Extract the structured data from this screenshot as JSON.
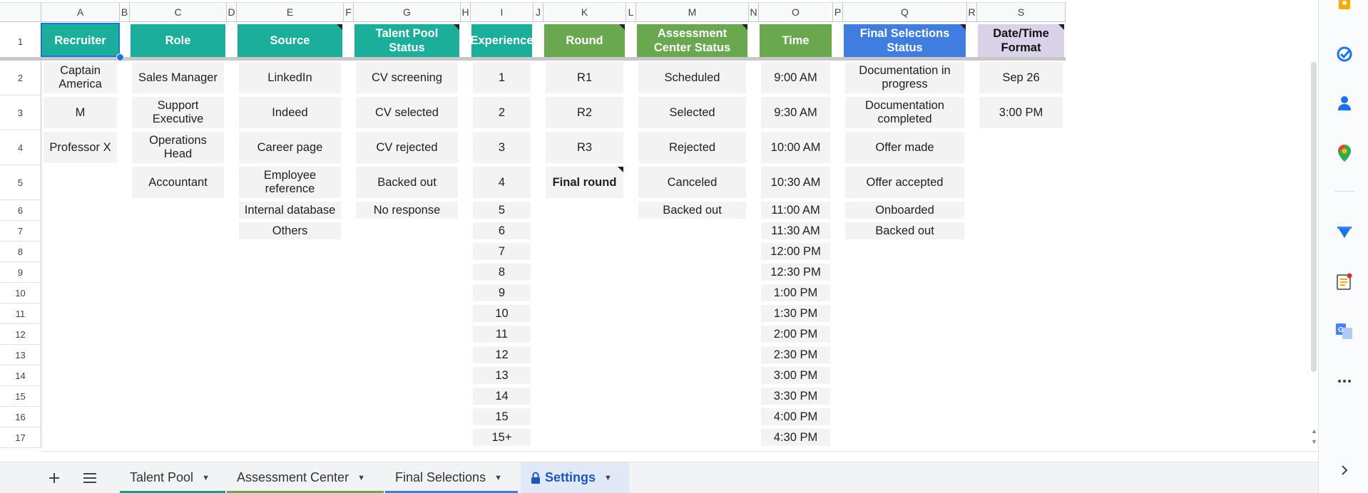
{
  "columns": [
    "A",
    "B",
    "C",
    "D",
    "E",
    "F",
    "G",
    "H",
    "I",
    "J",
    "K",
    "L",
    "M",
    "N",
    "O",
    "P",
    "Q",
    "R",
    "S"
  ],
  "rows": [
    "1",
    "2",
    "3",
    "4",
    "5",
    "6",
    "7",
    "8",
    "9",
    "10",
    "11",
    "12",
    "13",
    "14",
    "15",
    "16",
    "17"
  ],
  "headers": {
    "recruiter": "Recruiter",
    "role": "Role",
    "source": "Source",
    "talent_pool_status": "Talent Pool Status",
    "experience": "Experience",
    "round": "Round",
    "assessment_center_status": "Assessment Center Status",
    "time": "Time",
    "final_selections_status": "Final Selections Status",
    "date_time_format": "Date/Time Format"
  },
  "recruiter": [
    "Captain America",
    "M",
    "Professor X"
  ],
  "role": [
    "Sales Manager",
    "Support Executive",
    "Operations Head",
    "Accountant"
  ],
  "source": [
    "LinkedIn",
    "Indeed",
    "Career page",
    "Employee reference",
    "Internal database",
    "Others"
  ],
  "talent_pool_status": [
    "CV screening",
    "CV selected",
    "CV rejected",
    "Backed out",
    "No response"
  ],
  "experience": [
    "1",
    "2",
    "3",
    "4",
    "5",
    "6",
    "7",
    "8",
    "9",
    "10",
    "11",
    "12",
    "13",
    "14",
    "15",
    "15+"
  ],
  "round": [
    "R1",
    "R2",
    "R3",
    "Final round"
  ],
  "assessment_center_status": [
    "Scheduled",
    "Selected",
    "Rejected",
    "Canceled",
    "Backed out"
  ],
  "time": [
    "9:00 AM",
    "9:30 AM",
    "10:00 AM",
    "10:30 AM",
    "11:00 AM",
    "11:30 AM",
    "12:00 PM",
    "12:30 PM",
    "1:00 PM",
    "1:30 PM",
    "2:00 PM",
    "2:30 PM",
    "3:00 PM",
    "3:30 PM",
    "4:00 PM",
    "4:30 PM"
  ],
  "final_selections_status": [
    "Documentation in progress",
    "Documentation completed",
    "Offer made",
    "Offer accepted",
    "Onboarded",
    "Backed out"
  ],
  "date_time_format": [
    "Sep 26",
    "3:00 PM"
  ],
  "tabs": [
    {
      "label": "Talent Pool",
      "color": "#12a086"
    },
    {
      "label": "Assessment Center",
      "color": "#6aa84f"
    },
    {
      "label": "Final Selections",
      "color": "#3d7fd8"
    },
    {
      "label": "Settings",
      "color": "#3d7fd8",
      "locked": true
    }
  ],
  "colors": {
    "teal": "#1bae9a",
    "green": "#6aa84f",
    "blue": "#3f7ee0",
    "lavender": "#d9d2e9",
    "cell_bg": "#f3f3f3",
    "selection": "#1a73e8"
  },
  "sidebar_icons": [
    "keep-icon",
    "tasks-icon",
    "contacts-icon",
    "maps-icon",
    "forms-icon",
    "notes-addon-icon",
    "translate-icon",
    "more-icon",
    "expand-panel-icon"
  ]
}
